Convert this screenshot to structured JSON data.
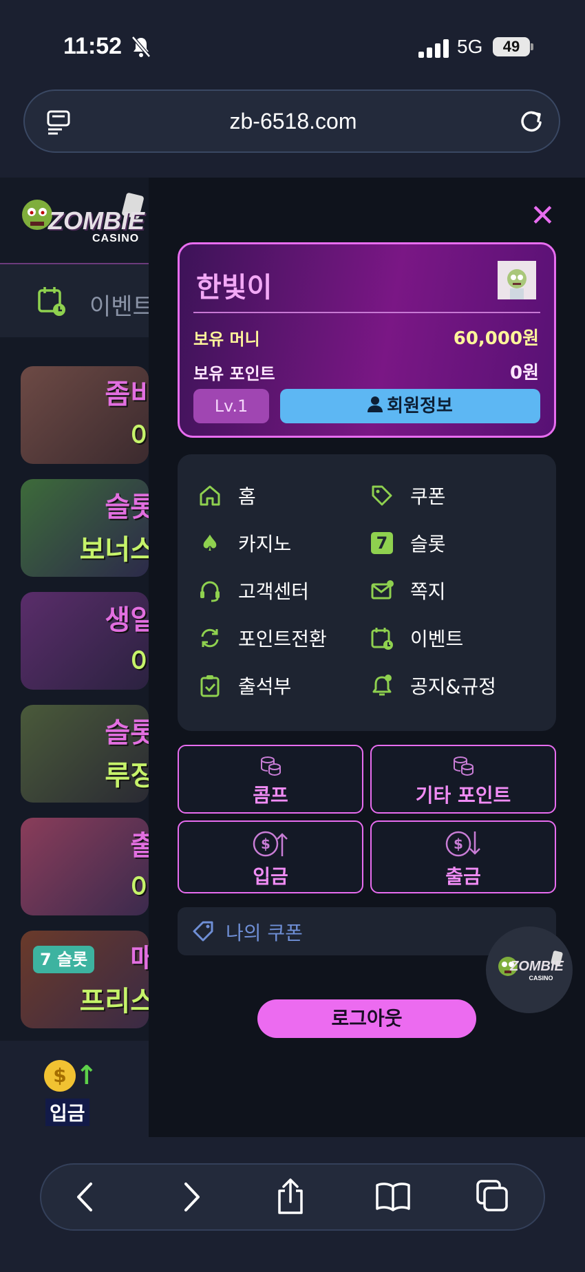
{
  "status_bar": {
    "time": "11:52",
    "network": "5G",
    "battery": "49"
  },
  "browser": {
    "url": "zb-6518.com"
  },
  "background_page": {
    "tab_label": "이벤트",
    "banners": [
      {
        "line1": "좀비",
        "line2": "이"
      },
      {
        "line1": "슬롯",
        "line2": "보너스"
      },
      {
        "line1": "생일",
        "line2": "이"
      },
      {
        "line1": "슬롯",
        "line2": "루징"
      },
      {
        "line1": "출",
        "line2": "이"
      },
      {
        "line1": "매",
        "line2": "프리스",
        "badge": "7 슬롯"
      }
    ],
    "bottom_nav": {
      "deposit_label": "입금"
    }
  },
  "drawer": {
    "user": {
      "nickname": "한빛이",
      "money_label": "보유 머니",
      "money_value": "60,000원",
      "points_label": "보유 포인트",
      "points_value": "0원",
      "level": "Lv.1",
      "member_info": "회원정보"
    },
    "menu": [
      {
        "label": "홈",
        "icon": "home-icon"
      },
      {
        "label": "쿠폰",
        "icon": "tag-icon"
      },
      {
        "label": "카지노",
        "icon": "spade-icon"
      },
      {
        "label": "슬롯",
        "icon": "seven-icon"
      },
      {
        "label": "고객센터",
        "icon": "headset-icon"
      },
      {
        "label": "쪽지",
        "icon": "mail-icon"
      },
      {
        "label": "포인트전환",
        "icon": "refresh-icon"
      },
      {
        "label": "이벤트",
        "icon": "calendar-icon"
      },
      {
        "label": "출석부",
        "icon": "clipboard-check-icon"
      },
      {
        "label": "공지&규정",
        "icon": "bell-icon"
      }
    ],
    "point_buttons": [
      {
        "label": "콤프",
        "icon": "coins-icon"
      },
      {
        "label": "기타 포인트",
        "icon": "coins-icon"
      },
      {
        "label": "입금",
        "icon": "dollar-up-icon"
      },
      {
        "label": "출금",
        "icon": "dollar-down-icon"
      }
    ],
    "coupon_label": "나의 쿠폰",
    "logout_label": "로그아웃"
  },
  "logo_text": {
    "main": "ZOMBIE",
    "sub": "CASINO"
  },
  "colors": {
    "accent": "#e86df0",
    "green": "#8fd14f",
    "blue": "#5db7f3",
    "gold": "#fff59a"
  }
}
